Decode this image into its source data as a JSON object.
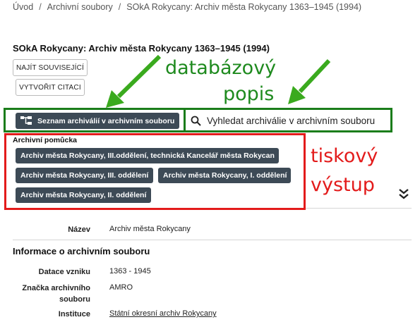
{
  "breadcrumb": {
    "items": [
      "Úvod",
      "Archivní soubory",
      "SOkA Rokycany: Archiv města Rokycany 1363–1945 (1994)"
    ],
    "separator": "/"
  },
  "title": "SOkA Rokycany: Archiv města Rokycany 1363–1945 (1994)",
  "actions": {
    "find_related": "NAJÍT SOUVISEJÍCÍ",
    "create_citation": "VYTVOŘIT CITACI"
  },
  "annotations": {
    "database_line1": "databázový",
    "database_line2": "popis",
    "print_line1": "tiskový",
    "print_line2": "výstup",
    "green": "#1b7d1b",
    "red": "#e31b1b"
  },
  "toolbar": {
    "list_button": "Seznam archiválií v archivním souboru",
    "list_icon": "tree-structure-icon",
    "search_placeholder": "Vyhledat archiválie v archivním souboru",
    "search_icon": "search-icon"
  },
  "finding_aids": {
    "label": "Archivní pomůcka",
    "items": [
      "Archiv města Rokycany, III.oddělení, technická Kancelář města Rokycan",
      "Archiv města Rokycany, III. oddělení",
      "Archiv města Rokycany, I. oddělení",
      "Archiv města Rokycany, II. oddělení"
    ]
  },
  "details": {
    "name_label": "Název",
    "name_value": "Archiv města Rokycany",
    "section_title": "Informace o archivním souboru",
    "rows": [
      {
        "label": "Datace vzniku",
        "value": "1363 - 1945"
      },
      {
        "label": "Značka archivního souboru",
        "value": "AMRO"
      },
      {
        "label": "Instituce",
        "value": "Státní okresní archiv Rokycany"
      }
    ]
  },
  "colors": {
    "button_dark": "#3d4a56"
  }
}
